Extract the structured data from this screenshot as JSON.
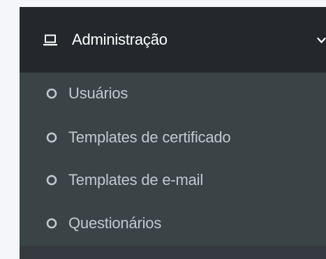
{
  "menu": {
    "title": "Administração",
    "icon": "laptop-icon",
    "expand_icon": "chevron-down-icon",
    "items": [
      {
        "label": "Usuários",
        "icon": "circle-icon"
      },
      {
        "label": "Templates de certificado",
        "icon": "circle-icon"
      },
      {
        "label": "Templates de e-mail",
        "icon": "circle-icon"
      },
      {
        "label": "Questionários",
        "icon": "circle-icon"
      }
    ]
  },
  "colors": {
    "page_background": "#f4f6f9",
    "sidebar_background": "#343a40",
    "header_background": "#24282d",
    "submenu_background": "#3a4447",
    "header_text": "#ffffff",
    "item_text": "#c2c7d0"
  }
}
